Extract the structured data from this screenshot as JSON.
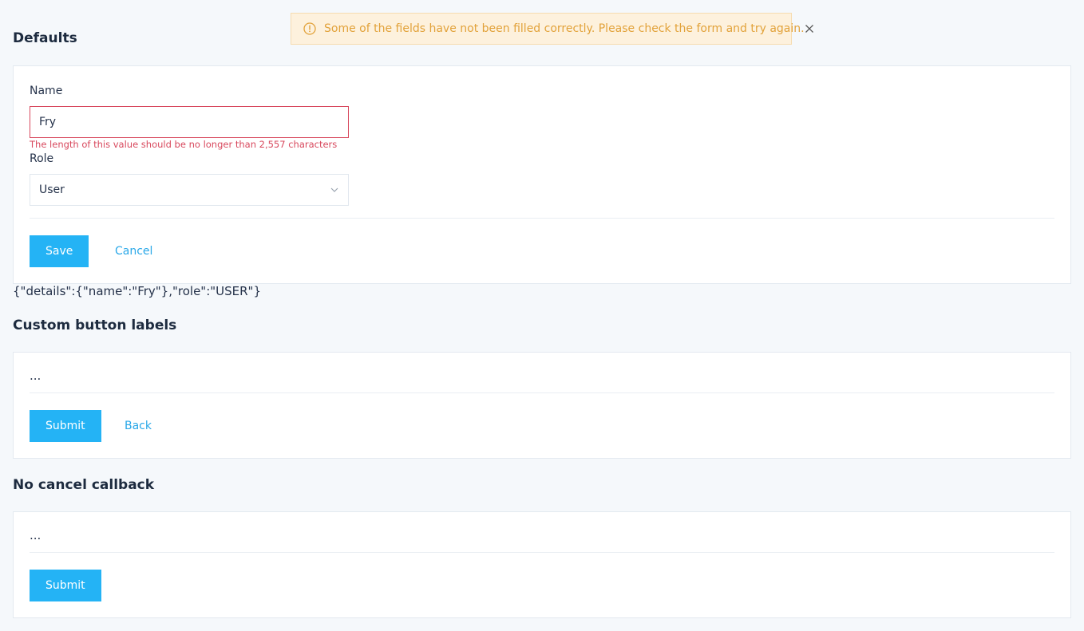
{
  "alert": {
    "message": "Some of the fields have not been filled correctly. Please check the form and try again.",
    "icon": "warning-circle-icon",
    "close_icon": "close-icon",
    "color": "#e2a23a"
  },
  "defaults": {
    "title": "Defaults",
    "name_label": "Name",
    "name_value": "Fry",
    "name_error": "The length of this value should be no longer than 2,557 characters",
    "role_label": "Role",
    "role_value": "User",
    "save_label": "Save",
    "cancel_label": "Cancel"
  },
  "json_output": "{\"details\":{\"name\":\"Fry\"},\"role\":\"USER\"}",
  "custom_labels": {
    "title": "Custom button labels",
    "content": "...",
    "submit_label": "Submit",
    "back_label": "Back"
  },
  "no_cancel": {
    "title": "No cancel callback",
    "content": "...",
    "submit_label": "Submit"
  },
  "colors": {
    "primary": "#24b3f5",
    "error": "#d8485d",
    "background": "#f5f8fb"
  }
}
